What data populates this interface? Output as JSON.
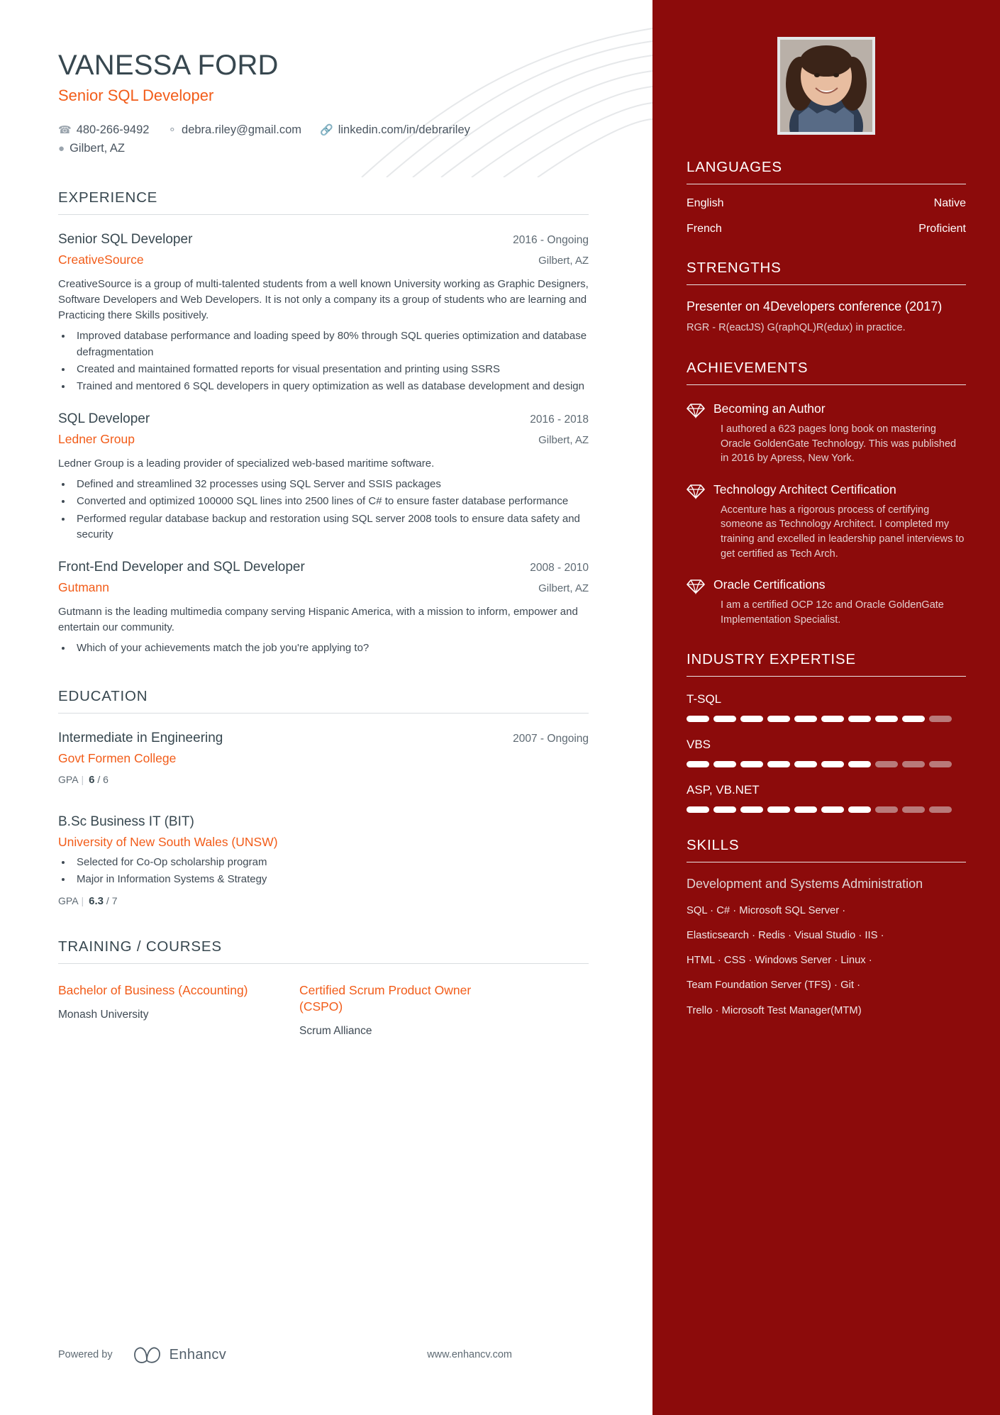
{
  "header": {
    "name": "VANESSA FORD",
    "job_title": "Senior SQL Developer",
    "contacts": [
      {
        "icon": "phone-icon",
        "value": "480-266-9492"
      },
      {
        "icon": "email-icon",
        "value": "debra.riley@gmail.com"
      },
      {
        "icon": "link-icon",
        "value": "linkedin.com/in/debrariley"
      },
      {
        "icon": "location-icon",
        "value": "Gilbert, AZ"
      }
    ]
  },
  "experience": {
    "title": "EXPERIENCE",
    "entries": [
      {
        "role": "Senior SQL Developer",
        "date": "2016 - Ongoing",
        "company": "CreativeSource",
        "location": "Gilbert, AZ",
        "description": "CreativeSource is a group of multi-talented students from a well known University working as Graphic Designers, Software Developers and Web Developers. It is not only a company its a group of students who are learning and Practicing there Skills positively.",
        "bullets": [
          "Improved database performance and loading speed by 80% through SQL queries optimization and database defragmentation",
          "Created and maintained formatted reports for visual presentation and printing using SSRS",
          "Trained and mentored 6 SQL developers in query optimization as well as  database development and design"
        ]
      },
      {
        "role": "SQL Developer",
        "date": "2016 - 2018",
        "company": "Ledner Group",
        "location": "Gilbert, AZ",
        "description": "Ledner Group is a leading provider of specialized web-based maritime software.",
        "bullets": [
          "Defined and streamlined 32 processes using SQL Server and SSIS packages",
          "Converted and optimized 100000 SQL lines into 2500 lines of C# to ensure faster database performance",
          "Performed regular database backup and restoration using SQL server 2008 tools to ensure data safety and security"
        ]
      },
      {
        "role": "Front-End Developer and SQL Developer",
        "date": "2008 - 2010",
        "company": "Gutmann",
        "location": "Gilbert, AZ",
        "description": "Gutmann is the leading multimedia company serving Hispanic America, with a mission to inform, empower and entertain our community.",
        "bullets": [
          "Which of your achievements match the job you're applying to?"
        ]
      }
    ]
  },
  "education": {
    "title": "EDUCATION",
    "entries": [
      {
        "degree": "Intermediate in Engineering",
        "date": "2007 - Ongoing",
        "school": "Govt Formen College",
        "bullets": [],
        "gpa_label": "GPA",
        "gpa_value": "6",
        "gpa_max": "/ 6"
      },
      {
        "degree": "B.Sc Business IT (BIT)",
        "date": "",
        "school": "University of New South Wales (UNSW)",
        "bullets": [
          "Selected for Co-Op scholarship program",
          "Major in Information Systems & Strategy"
        ],
        "gpa_label": "GPA",
        "gpa_value": "6.3",
        "gpa_max": "/ 7"
      }
    ]
  },
  "training": {
    "title": "TRAINING / COURSES",
    "courses": [
      {
        "name": "Bachelor of Business (Accounting)",
        "org": "Monash University"
      },
      {
        "name": "Certified Scrum Product Owner (CSPO)",
        "org": "Scrum Alliance"
      }
    ]
  },
  "footer": {
    "powered_by": "Powered by",
    "brand": "Enhancv",
    "url": "www.enhancv.com"
  },
  "sidebar": {
    "languages": {
      "title": "LANGUAGES",
      "items": [
        {
          "name": "English",
          "level": "Native"
        },
        {
          "name": "French",
          "level": "Proficient"
        }
      ]
    },
    "strengths": {
      "title": "STRENGTHS",
      "items": [
        {
          "name": "Presenter on 4Developers conference (2017)",
          "description": " RGR - R(eactJS) G(raphQL)R(edux) in practice."
        }
      ]
    },
    "achievements": {
      "title": "ACHIEVEMENTS",
      "items": [
        {
          "icon": "diamond-icon",
          "name": "Becoming an Author",
          "description": "I authored a 623 pages long book on mastering Oracle GoldenGate Technology. This was published in 2016 by Apress, New York."
        },
        {
          "icon": "diamond-icon",
          "name": "Technology Architect Certification",
          "description": "Accenture has a rigorous process of certifying someone as Technology Architect. I completed my training and excelled in leadership panel interviews to get certified as Tech Arch."
        },
        {
          "icon": "diamond-icon",
          "name": "Oracle Certifications",
          "description": "I am a certified OCP 12c and Oracle GoldenGate Implementation Specialist."
        }
      ]
    },
    "industry_expertise": {
      "title": "INDUSTRY EXPERTISE",
      "items": [
        {
          "name": "T-SQL",
          "filled": 9,
          "total": 10
        },
        {
          "name": "VBS",
          "filled": 7,
          "total": 10
        },
        {
          "name": "ASP, VB.NET",
          "filled": 7,
          "total": 10
        }
      ]
    },
    "skills": {
      "title": "SKILLS",
      "group": "Development and Systems Administration",
      "lines": [
        "SQL · C# · Microsoft SQL Server ·",
        "Elasticsearch · Redis · Visual Studio ·  IIS  ·",
        "HTML · CSS · Windows Server · Linux ·",
        "Team Foundation Server (TFS) · Git ·",
        "Trello · Microsoft Test Manager(MTM)"
      ]
    }
  },
  "colors": {
    "accent_orange": "#f25c19",
    "sidebar_red": "#8c0b0b",
    "heading_dark": "#37474f"
  }
}
